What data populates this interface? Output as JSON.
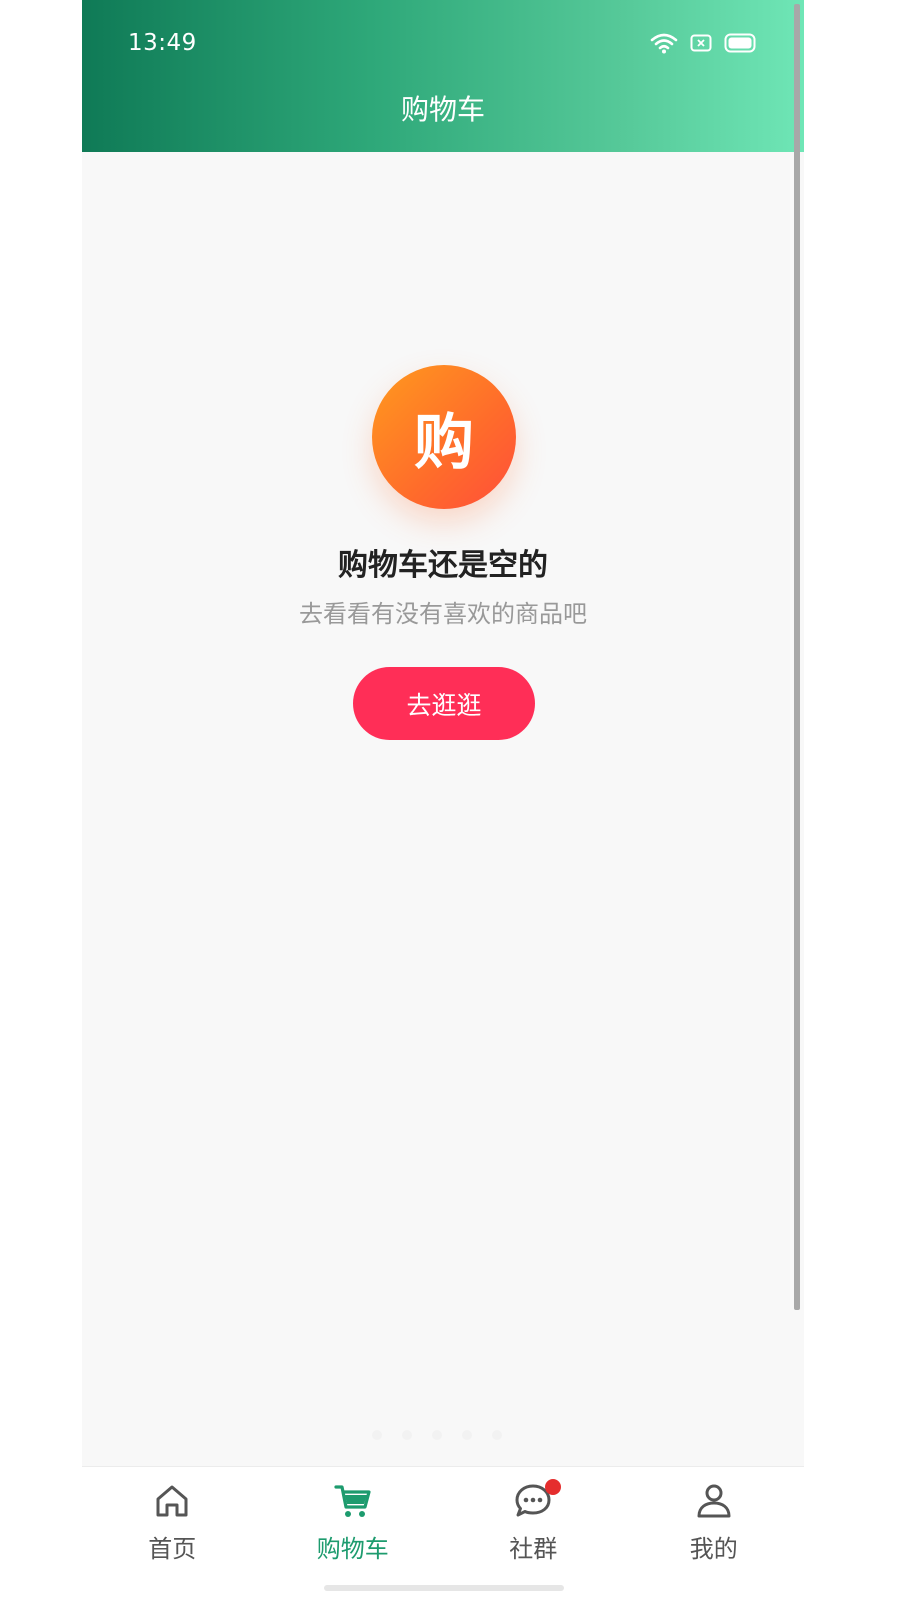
{
  "status_bar": {
    "time": "13:49"
  },
  "header": {
    "title": "购物车"
  },
  "empty_state": {
    "icon_text": "购",
    "title": "购物车还是空的",
    "subtitle": "去看看有没有喜欢的商品吧",
    "button_label": "去逛逛"
  },
  "tabbar": {
    "items": [
      {
        "label": "首页",
        "icon": "home-icon",
        "active": false
      },
      {
        "label": "购物车",
        "icon": "cart-icon",
        "active": true
      },
      {
        "label": "社群",
        "icon": "chat-icon",
        "active": false,
        "badge": true
      },
      {
        "label": "我的",
        "icon": "user-icon",
        "active": false
      }
    ]
  },
  "colors": {
    "header_gradient_start": "#0f7a56",
    "header_gradient_end": "#6fe6b6",
    "accent_green": "#1d9b6e",
    "button_red": "#ff2e57",
    "icon_orange": "#ff7a2a",
    "badge_red": "#e52e2e"
  }
}
